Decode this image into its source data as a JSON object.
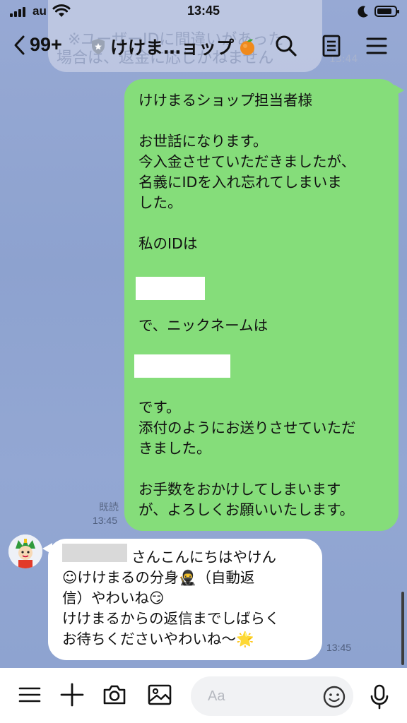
{
  "status_bar": {
    "carrier": "au",
    "time": "13:45",
    "battery_level": 0.85
  },
  "header": {
    "back_count": "99+",
    "chat_title": "けけま…ョップ",
    "icons": [
      "back-chevron-icon",
      "shield-icon",
      "orange-emoji-icon",
      "search-icon",
      "notes-icon",
      "menu-icon"
    ]
  },
  "previous_message": {
    "line1": "※ユーザーIDに間違いがあった",
    "line2": "場合は、返金に応じかねません",
    "time": "13:44"
  },
  "messages": [
    {
      "direction": "outgoing",
      "text": "けけまるショップ担当者様\n\nお世話になります。\n今入金させていただきましたが、\n名義にIDを入れ忘れてしまいま\nした。\n\n私のIDは\n\n\n\nで、ニックネームは\n\n\n\nです。\n添付のようにお送りさせていただ\nきました。\n\nお手数をおかけしてしまいます\nが、よろしくお願いいたします。",
      "read_label": "既読",
      "time": "13:45"
    },
    {
      "direction": "incoming",
      "text": "さんこんにちはやけん\n☺けけまるの分身🥷（自動返\n信）やわいね😏\nけけまるからの返信までしばらく\nお待ちくださいやわいね〜🌟",
      "time": "13:45"
    }
  ],
  "input_bar": {
    "placeholder": "Aa",
    "icons": [
      "menu-icon",
      "plus-icon",
      "camera-icon",
      "image-icon",
      "emoji-icon",
      "microphone-icon"
    ]
  },
  "colors": {
    "chat_background": "#8fa4d1",
    "outgoing_bubble": "#85dd7a",
    "incoming_bubble": "#ffffff"
  }
}
